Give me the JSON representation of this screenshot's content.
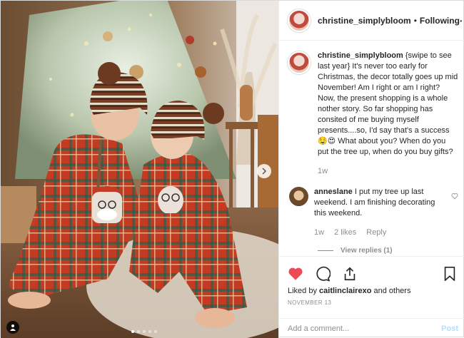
{
  "header": {
    "username": "christine_simplybloom",
    "separator": "•",
    "follow_status": "Following",
    "more": "···"
  },
  "caption": {
    "username": "christine_simplybloom",
    "text": "{swipe to see last year} It's never too early for Christmas, the decor totally goes up mid November! Am I right or am I right? Now, the present shopping is a whole nother story. So far shopping has consited of me buying myself presents....so, I'd say that's a success 🤤😍 What about you? When do you put the tree up, when do you buy gifts?",
    "age": "1w"
  },
  "reply": {
    "username": "anneslane",
    "text": "I put my tree up last weekend. I am finishing decorating this weekend.",
    "age": "1w",
    "likes": "2 likes",
    "reply_label": "Reply",
    "view_replies": "View replies (1)"
  },
  "likes": {
    "prefix": "Liked by",
    "user": "caitlinclairexo",
    "suffix": "and others"
  },
  "date": "NOVEMBER 13",
  "comment_box": {
    "placeholder": "Add a comment...",
    "post_label": "Post"
  },
  "colors": {
    "like_red": "#ed4956",
    "post_disabled": "#b2dffc",
    "muted": "#8e8e8e"
  },
  "carousel": {
    "slides": 5,
    "active": 1
  }
}
